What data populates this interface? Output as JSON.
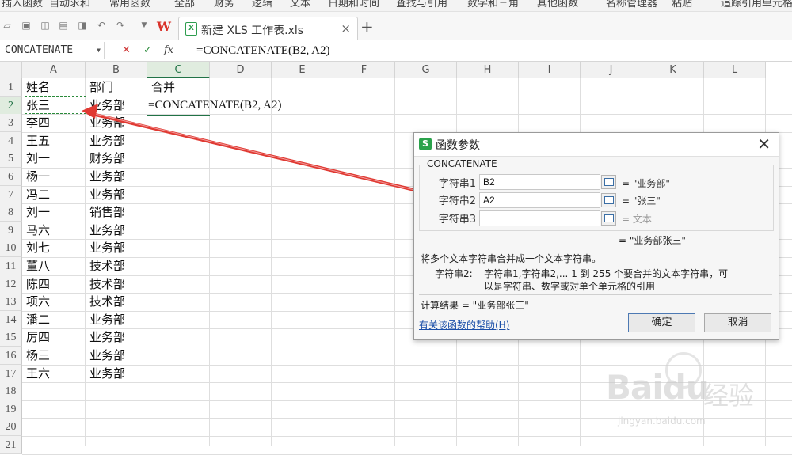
{
  "menu_strip": [
    "插入函数",
    "自动求和",
    "常用函数",
    "全部",
    "财务",
    "逻辑",
    "文本",
    "日期和时间",
    "查找与引用",
    "数学和三角",
    "其他函数",
    "名称管理器",
    "粘贴",
    "追踪引用单元格"
  ],
  "toolbar": {
    "tab_title": "新建 XLS 工作表.xls",
    "close_label": "×",
    "add_label": "+"
  },
  "formula_bar": {
    "name_box": "CONCATENATE",
    "cancel": "✕",
    "confirm": "✓",
    "fx": "fx",
    "formula": "=CONCATENATE(B2, A2)"
  },
  "columns": [
    "A",
    "B",
    "C",
    "D",
    "E",
    "F",
    "G",
    "H",
    "I",
    "J",
    "K",
    "L"
  ],
  "rows": [
    "1",
    "2",
    "3",
    "4",
    "5",
    "6",
    "7",
    "8",
    "9",
    "10",
    "11",
    "12",
    "13",
    "14",
    "15",
    "16",
    "17",
    "18",
    "19",
    "20",
    "21"
  ],
  "sheet": {
    "headers": {
      "a": "姓名",
      "b": "部门",
      "c": "合并"
    },
    "c2_formula": "=CONCATENATE(B2, A2)",
    "data": [
      {
        "name": "张三",
        "dept": "业务部"
      },
      {
        "name": "李四",
        "dept": "业务部"
      },
      {
        "name": "王五",
        "dept": "业务部"
      },
      {
        "name": "刘一",
        "dept": "财务部"
      },
      {
        "name": "杨一",
        "dept": "业务部"
      },
      {
        "name": "冯二",
        "dept": "业务部"
      },
      {
        "name": "刘一",
        "dept": "销售部"
      },
      {
        "name": "马六",
        "dept": "业务部"
      },
      {
        "name": "刘七",
        "dept": "业务部"
      },
      {
        "name": "董八",
        "dept": "技术部"
      },
      {
        "name": "陈四",
        "dept": "技术部"
      },
      {
        "name": "项六",
        "dept": "技术部"
      },
      {
        "name": "潘二",
        "dept": "业务部"
      },
      {
        "name": "厉四",
        "dept": "业务部"
      },
      {
        "name": "杨三",
        "dept": "业务部"
      },
      {
        "name": "王六",
        "dept": "业务部"
      }
    ]
  },
  "dialog": {
    "icon": "S",
    "title": "函数参数",
    "close": "✕",
    "function_name": "CONCATENATE",
    "args": [
      {
        "label": "字符串1",
        "value": "B2",
        "result": "= \"业务部\""
      },
      {
        "label": "字符串2",
        "value": "A2",
        "result": "= \"张三\""
      },
      {
        "label": "字符串3",
        "value": "",
        "result": "= 文本"
      }
    ],
    "formula_result": "= \"业务部张三\"",
    "description": "将多个文本字符串合并成一个文本字符串。",
    "arg_desc_label": "字符串2:",
    "arg_desc_line1": "字符串1,字符串2,... 1 到 255 个要合并的文本字符串，可",
    "arg_desc_line2": "以是字符串、数字或对单个单元格的引用",
    "calc_result": "计算结果 = \"业务部张三\"",
    "help_link": "有关该函数的帮助(H)",
    "ok": "确定",
    "cancel": "取消"
  },
  "watermark": {
    "brand": "Bai",
    "brand2": "du",
    "cn": "经验",
    "url": "jingyan.baidu.com"
  }
}
